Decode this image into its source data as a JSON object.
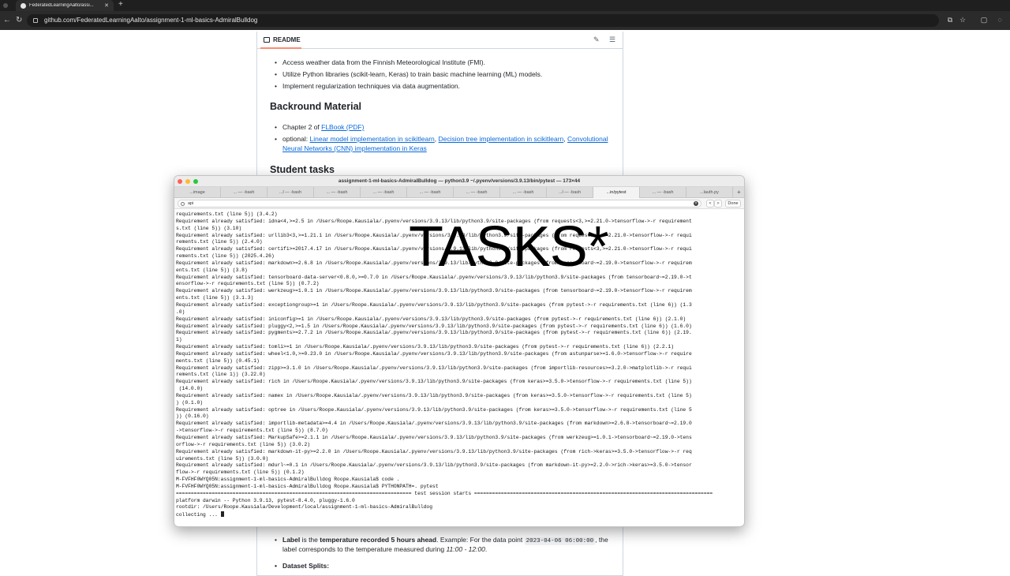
{
  "browser": {
    "tab_title": "FederatedLearningAalto/assi...",
    "url": "github.com/FederatedLearningAalto/assignment-1-ml-basics-AdmiralBulldog"
  },
  "readme": {
    "tab_label": "README",
    "goals": [
      "Access weather data from the Finnish Meteorological Institute (FMI).",
      "Utilize Python libraries (scikit-learn, Keras) to train basic machine learning (ML) models.",
      "Implement regularization techniques via data augmentation."
    ],
    "background_heading": "Backround Material",
    "chapter_prefix": "Chapter 2 of ",
    "chapter_link": "FLBook (PDF)",
    "optional_prefix": "optional: ",
    "optional_link_1": "Linear model implementation in scikitlearn",
    "optional_sep_1": ", ",
    "optional_link_2": "Decision tree implementation in scikitlearn",
    "optional_sep_2": ", ",
    "optional_link_3a": "Convolutional",
    "optional_link_3b": "Neural Networks (CNN) implementation in Keras",
    "tasks_heading": "Student tasks",
    "label_prefix": "Label",
    "label_mid": " is the ",
    "label_bold": "temperature recorded 5 hours ahead",
    "label_example": ". Example: For the data point ",
    "label_code": "2023-04-06 06:00:00",
    "label_after_code": ", the",
    "label_line2_a": "label corresponds to the temperature measured during ",
    "label_line2_em": "11:00 - 12:00",
    "label_line2_end": ".",
    "splits_label": "Dataset Splits:"
  },
  "terminal": {
    "title": "assignment-1-ml-basics-AdmiralBulldog — python3.9 ~/.pyenv/versions/3.9.13/bin/pytest — 173×44",
    "tabs": [
      "...image",
      "... — -bash",
      "...l — -bash",
      "... — -bash",
      "... — -bash",
      "... — -bash",
      "... — -bash",
      "... — -bash",
      "...l — -bash",
      "...in/pytest",
      "... — -bash",
      "...lauth.py"
    ],
    "find_query": "api",
    "find_done": "Done",
    "find_prev": "<",
    "find_next": ">",
    "lines": [
      "requirements.txt (line 5)) (3.4.2)",
      "Requirement already satisfied: idna<4,>=2.5 in /Users/Roope.Kausiala/.pyenv/versions/3.9.13/lib/python3.9/site-packages (from requests<3,>=2.21.0->tensorflow->-r requirement",
      "s.txt (line 5)) (3.10)",
      "Requirement already satisfied: urllib3<3,>=1.21.1 in /Users/Roope.Kausiala/.pyenv/versions/3.9.13/lib/python3.9/site-packages (from requests<3,>=2.21.0->tensorflow->-r requi",
      "rements.txt (line 5)) (2.4.0)",
      "Requirement already satisfied: certifi>=2017.4.17 in /Users/Roope.Kausiala/.pyenv/versions/3.9.13/lib/python3.9/site-packages (from requests<3,>=2.21.0->tensorflow->-r requi",
      "rements.txt (line 5)) (2025.4.26)",
      "Requirement already satisfied: markdown>=2.6.8 in /Users/Roope.Kausiala/.pyenv/versions/3.9.13/lib/python3.9/site-packages (from tensorboard~=2.19.0->tensorflow->-r requirem",
      "ents.txt (line 5)) (3.8)",
      "Requirement already satisfied: tensorboard-data-server<0.8.0,>=0.7.0 in /Users/Roope.Kausiala/.pyenv/versions/3.9.13/lib/python3.9/site-packages (from tensorboard~=2.19.0->t",
      "ensorflow->-r requirements.txt (line 5)) (0.7.2)",
      "Requirement already satisfied: werkzeug>=1.0.1 in /Users/Roope.Kausiala/.pyenv/versions/3.9.13/lib/python3.9/site-packages (from tensorboard~=2.19.0->tensorflow->-r requirem",
      "ents.txt (line 5)) (3.1.3)",
      "Requirement already satisfied: exceptiongroup>=1 in /Users/Roope.Kausiala/.pyenv/versions/3.9.13/lib/python3.9/site-packages (from pytest->-r requirements.txt (line 6)) (1.3",
      ".0)",
      "Requirement already satisfied: iniconfig>=1 in /Users/Roope.Kausiala/.pyenv/versions/3.9.13/lib/python3.9/site-packages (from pytest->-r requirements.txt (line 6)) (2.1.0)",
      "Requirement already satisfied: pluggy<2,>=1.5 in /Users/Roope.Kausiala/.pyenv/versions/3.9.13/lib/python3.9/site-packages (from pytest->-r requirements.txt (line 6)) (1.6.0)",
      "Requirement already satisfied: pygments>=2.7.2 in /Users/Roope.Kausiala/.pyenv/versions/3.9.13/lib/python3.9/site-packages (from pytest->-r requirements.txt (line 6)) (2.19.",
      "1)",
      "Requirement already satisfied: tomli>=1 in /Users/Roope.Kausiala/.pyenv/versions/3.9.13/lib/python3.9/site-packages (from pytest->-r requirements.txt (line 6)) (2.2.1)",
      "Requirement already satisfied: wheel<1.0,>=0.23.0 in /Users/Roope.Kausiala/.pyenv/versions/3.9.13/lib/python3.9/site-packages (from astunparse>=1.6.0->tensorflow->-r require",
      "ments.txt (line 5)) (0.45.1)",
      "Requirement already satisfied: zipp>=3.1.0 in /Users/Roope.Kausiala/.pyenv/versions/3.9.13/lib/python3.9/site-packages (from importlib-resources>=3.2.0->matplotlib->-r requi",
      "rements.txt (line 1)) (3.22.0)",
      "Requirement already satisfied: rich in /Users/Roope.Kausiala/.pyenv/versions/3.9.13/lib/python3.9/site-packages (from keras>=3.5.0->tensorflow->-r requirements.txt (line 5))",
      " (14.0.0)",
      "Requirement already satisfied: namex in /Users/Roope.Kausiala/.pyenv/versions/3.9.13/lib/python3.9/site-packages (from keras>=3.5.0->tensorflow->-r requirements.txt (line 5)",
      ") (0.1.0)",
      "Requirement already satisfied: optree in /Users/Roope.Kausiala/.pyenv/versions/3.9.13/lib/python3.9/site-packages (from keras>=3.5.0->tensorflow->-r requirements.txt (line 5",
      ")) (0.16.0)",
      "Requirement already satisfied: importlib-metadata>=4.4 in /Users/Roope.Kausiala/.pyenv/versions/3.9.13/lib/python3.9/site-packages (from markdown>=2.6.8->tensorboard~=2.19.0",
      "->tensorflow->-r requirements.txt (line 5)) (8.7.0)",
      "Requirement already satisfied: MarkupSafe>=2.1.1 in /Users/Roope.Kausiala/.pyenv/versions/3.9.13/lib/python3.9/site-packages (from werkzeug>=1.0.1->tensorboard~=2.19.0->tens",
      "orflow->-r requirements.txt (line 5)) (3.0.2)",
      "Requirement already satisfied: markdown-it-py>=2.2.0 in /Users/Roope.Kausiala/.pyenv/versions/3.9.13/lib/python3.9/site-packages (from rich->keras>=3.5.0->tensorflow->-r req",
      "uirements.txt (line 5)) (3.0.0)",
      "Requirement already satisfied: mdurl~=0.1 in /Users/Roope.Kausiala/.pyenv/versions/3.9.13/lib/python3.9/site-packages (from markdown-it-py>=2.2.0->rich->keras>=3.5.0->tensor",
      "flow->-r requirements.txt (line 5)) (0.1.2)",
      "M-FVFHF0WYQ05N:assignment-1-ml-basics-AdmiralBulldog Roope.Kausiala$ code .",
      "M-FVFHF0WYQ05N:assignment-1-ml-basics-AdmiralBulldog Roope.Kausiala$ PYTHONPATH=. pytest",
      "=============================================================================== test session starts ================================================================================",
      "platform darwin -- Python 3.9.13, pytest-8.4.0, pluggy-1.6.0",
      "rootdir: /Users/Roope.Kausiala/Development/local/assignment-1-ml-basics-AdmiralBulldog",
      "collecting ... "
    ]
  },
  "overlay_text": "TASKS*"
}
